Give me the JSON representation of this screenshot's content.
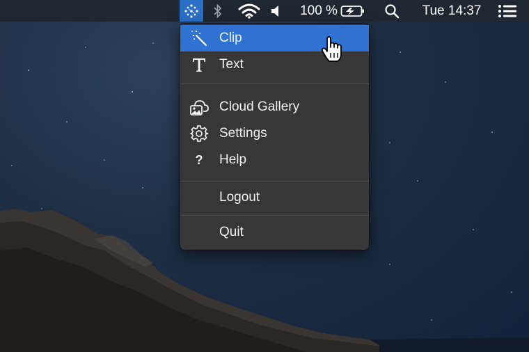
{
  "menubar": {
    "app_icon": "clip-app-icon",
    "bluetooth_icon": "bluetooth-icon",
    "wifi_icon": "wifi-icon",
    "volume_icon": "speaker-icon",
    "battery_percent": "100 %",
    "battery_icon": "battery-charging-icon",
    "search_icon": "search-icon",
    "clock": "Tue 14:37",
    "list_icon": "notification-list-icon"
  },
  "menu": {
    "items": [
      {
        "label": "Clip",
        "icon": "magic-wand-icon",
        "highlighted": true
      },
      {
        "label": "Text",
        "icon": "text-T-icon"
      },
      {
        "label": "Cloud Gallery",
        "icon": "cloud-gallery-icon"
      },
      {
        "label": "Settings",
        "icon": "gear-icon"
      },
      {
        "label": "Help",
        "icon": "question-icon",
        "icon_glyph": "?"
      },
      {
        "label": "Logout"
      },
      {
        "label": "Quit"
      }
    ]
  },
  "colors": {
    "menubar_bg": "#1f2733",
    "menu_bg": "#373737",
    "highlight": "#2f72d2",
    "app_icon_bg": "#2a6fc6"
  }
}
